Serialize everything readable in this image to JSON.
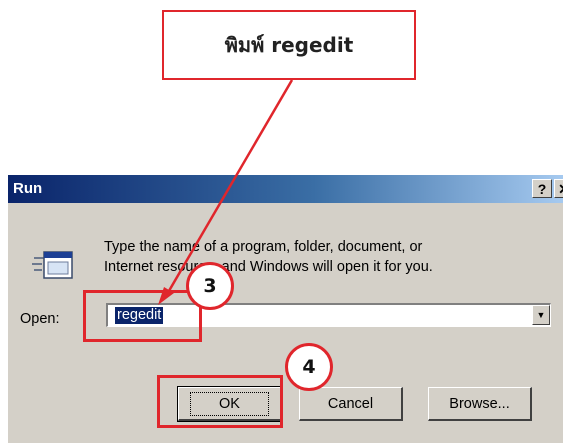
{
  "callout": {
    "text": "พิมพ์ regedit"
  },
  "dialog": {
    "title": "Run",
    "help_glyph": "?",
    "close_glyph": "✕",
    "message_lines": [
      "Type the name of a program, folder, document, or",
      "Internet resource, and Windows will open it for you."
    ],
    "open_label": "Open:",
    "open_value": "regedit",
    "dropdown_glyph": "▼",
    "buttons": {
      "ok": "OK",
      "cancel": "Cancel",
      "browse": "Browse..."
    }
  },
  "steps": [
    "3",
    "4"
  ],
  "colors": {
    "annotation": "#e0262c",
    "titlebar_start": "#0a246a",
    "titlebar_end": "#a6caf0",
    "dialog_bg": "#d4d0c8"
  }
}
